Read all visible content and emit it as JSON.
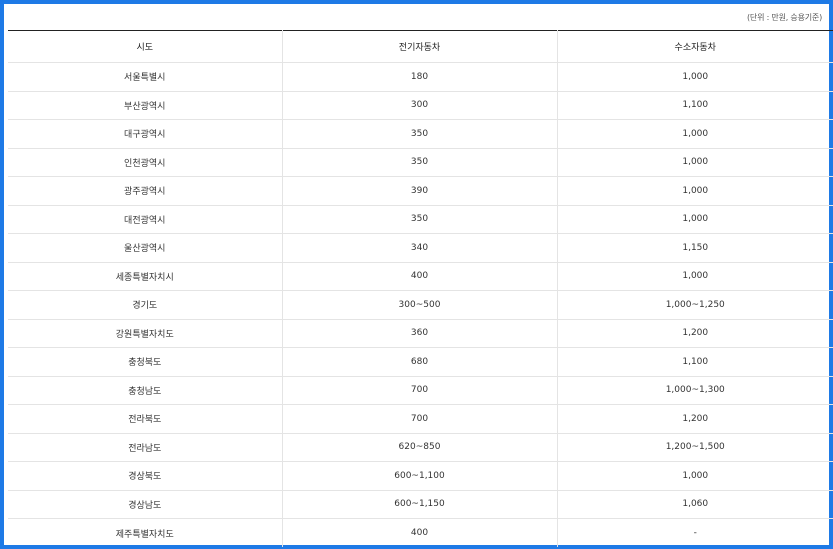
{
  "unit_note": "(단위 : 만원, 승용기준)",
  "table": {
    "headers": [
      "시도",
      "전기자동차",
      "수소자동차"
    ],
    "rows": [
      [
        "서울특별시",
        "180",
        "1,000"
      ],
      [
        "부산광역시",
        "300",
        "1,100"
      ],
      [
        "대구광역시",
        "350",
        "1,000"
      ],
      [
        "인천광역시",
        "350",
        "1,000"
      ],
      [
        "광주광역시",
        "390",
        "1,000"
      ],
      [
        "대전광역시",
        "350",
        "1,000"
      ],
      [
        "울산광역시",
        "340",
        "1,150"
      ],
      [
        "세종특별자치시",
        "400",
        "1,000"
      ],
      [
        "경기도",
        "300~500",
        "1,000~1,250"
      ],
      [
        "강원특별자치도",
        "360",
        "1,200"
      ],
      [
        "충청북도",
        "680",
        "1,100"
      ],
      [
        "충청남도",
        "700",
        "1,000~1,300"
      ],
      [
        "전라북도",
        "700",
        "1,200"
      ],
      [
        "전라남도",
        "620~850",
        "1,200~1,500"
      ],
      [
        "경상북도",
        "600~1,100",
        "1,000"
      ],
      [
        "경상남도",
        "600~1,150",
        "1,060"
      ],
      [
        "제주특별자치도",
        "400",
        "-"
      ]
    ]
  }
}
